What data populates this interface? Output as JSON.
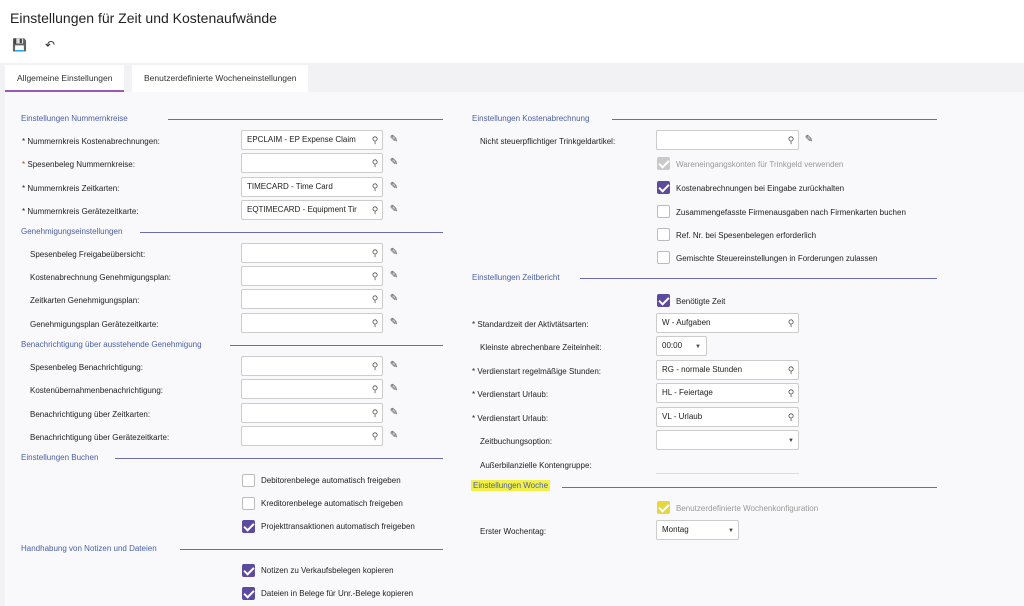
{
  "page": {
    "title": "Einstellungen für Zeit und Kostenaufwände"
  },
  "toolbar": {
    "save_icon": "save-icon",
    "undo_icon": "undo-icon"
  },
  "tabs": [
    {
      "label": "Allgemeine Einstellungen"
    },
    {
      "label": "Benutzerdefinierte Wocheneinstellungen"
    }
  ],
  "left": {
    "nummernkreise": {
      "title": "Einstellungen Nummernkreise",
      "fields": [
        {
          "label": "Nummernkreis Kostenabrechnungen:",
          "value": "EPCLAIM - EP Expense Claim",
          "req": "*"
        },
        {
          "label": "Spesenbeleg Nummernkreise:",
          "value": "",
          "req": "*"
        },
        {
          "label": "Nummernkreis Zeitkarten:",
          "value": "TIMECARD - Time Card",
          "req": "*"
        },
        {
          "label": "Nummernkreis Gerätezeitkarte:",
          "value": "EQTIMECARD - Equipment Tir",
          "req": "*"
        }
      ]
    },
    "genehmigung": {
      "title": "Genehmigungseinstellungen",
      "fields": [
        {
          "label": "Spesenbeleg Freigabeübersicht:",
          "value": ""
        },
        {
          "label": "Kostenabrechnung Genehmigungsplan:",
          "value": ""
        },
        {
          "label": "Zeitkarten Genehmigungsplan:",
          "value": ""
        },
        {
          "label": "Genehmigungsplan Gerätezeitkarte:",
          "value": ""
        }
      ]
    },
    "benachrichtigung": {
      "title": "Benachrichtigung über ausstehende Genehmigung",
      "fields": [
        {
          "label": "Spesenbeleg Benachrichtigung:",
          "value": ""
        },
        {
          "label": "Kostenübernahmenbenachrichtigung:",
          "value": ""
        },
        {
          "label": "Benachrichtigung über Zeitkarten:",
          "value": ""
        },
        {
          "label": "Benachrichtigung über Gerätezeitkarte:",
          "value": ""
        }
      ]
    },
    "buchen": {
      "title": "Einstellungen Buchen",
      "checkboxes": [
        {
          "label": "Debitorenbelege automatisch freigeben",
          "checked": false
        },
        {
          "label": "Kreditorenbelege automatisch freigeben",
          "checked": false
        },
        {
          "label": "Projekttransaktionen automatisch freigeben",
          "checked": true
        }
      ]
    },
    "notizen": {
      "title": "Handhabung von Notizen und Dateien",
      "checkboxes": [
        {
          "label": "Notizen zu Verkaufsbelegen kopieren",
          "checked": true
        },
        {
          "label": "Dateien in Belege für Unr.-Belege kopieren",
          "checked": true
        }
      ]
    }
  },
  "right": {
    "kosten": {
      "title": "Einstellungen Kostenabrechnung",
      "trinkgeld_label": "Nicht steuerpflichtiger Trinkgeldartikel:",
      "trinkgeld_value": "",
      "checkboxes": [
        {
          "label": "Wareneingangskonten für Trinkgeld verwenden",
          "state": "disabled"
        },
        {
          "label": "Kostenabrechnungen bei Eingabe zurückhalten",
          "state": "checked"
        },
        {
          "label": "Zusammengefasste Firmenausgaben nach Firmenkarten buchen",
          "state": "unchecked"
        },
        {
          "label": "Ref. Nr. bei Spesenbelegen erforderlich",
          "state": "unchecked"
        },
        {
          "label": "Gemischte Steuereinstellungen in Forderungen zulassen",
          "state": "unchecked"
        }
      ]
    },
    "zeitbericht": {
      "title": "Einstellungen Zeitbericht",
      "benoetigte_zeit": "Benötigte Zeit",
      "fields": [
        {
          "label": "Standardzeit der Aktivtätsarten:",
          "value": "W - Aufgaben",
          "req": "*",
          "kind": "lookup"
        },
        {
          "label": "Kleinste abrechenbare Zeiteinheit:",
          "value": "00:00",
          "req": "",
          "kind": "select"
        },
        {
          "label": "Verdienstart regelmäßige Stunden:",
          "value": "RG - normale Stunden",
          "req": "*",
          "kind": "lookup"
        },
        {
          "label": "Verdienstart Urlaub:",
          "value": "HL - Feiertage",
          "req": "*",
          "kind": "lookup"
        },
        {
          "label": "Verdienstart Urlaub:",
          "value": "VL - Urlaub",
          "req": "*",
          "kind": "lookup"
        },
        {
          "label": "Zeitbuchungsoption:",
          "value": "",
          "req": "",
          "kind": "select"
        },
        {
          "label": "Außerbilanzielle Kontengruppe:",
          "value": "",
          "req": "",
          "kind": "none"
        }
      ]
    },
    "woche": {
      "title": "Einstellungen Woche",
      "custom_week_label": "Benutzerdefinierte Wochenkonfiguration",
      "first_day_label": "Erster Wochentag:",
      "first_day_value": "Montag"
    }
  },
  "colors": {
    "accent": "#5b4a9e",
    "section": "#4a5fa3",
    "highlight": "#f3f04a"
  }
}
